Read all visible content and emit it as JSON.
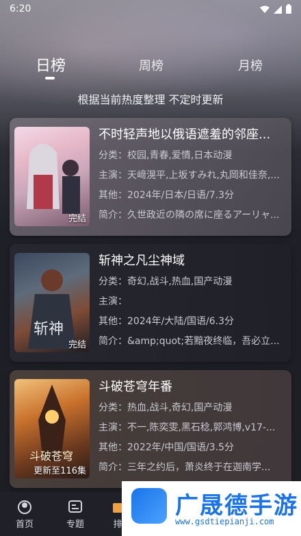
{
  "status_bar": {
    "time": "6:20"
  },
  "tabs": [
    {
      "label": "日榜",
      "active": true
    },
    {
      "label": "周榜",
      "active": false
    },
    {
      "label": "月榜",
      "active": false
    }
  ],
  "subtitle": "根据当前热度整理 不定时更新",
  "cards": [
    {
      "title": "不时轻声地以俄语遮羞的邻座...",
      "category": "分类：校园,青春,爱情,日本动漫",
      "cast": "主演：天﨑滉平,上坂すみれ,丸岡和佳奈,...",
      "other": "其他：2024年/日本/日语/7.3分",
      "summary": "简介：久世政近の隣の席に座るアーリャ...",
      "badge": "完结"
    },
    {
      "title": "斩神之凡尘神域",
      "category": "分类：奇幻,战斗,热血,国产动漫",
      "cast": "主演：",
      "other": "其他：2024年/大陆/国语/6.3分",
      "summary": "简介：&amp;quot;若黯夜终临，吾必立...",
      "badge": "完结"
    },
    {
      "title": "斗破苍穹年番",
      "category": "分类：热血,战斗,奇幻,国产动漫",
      "cast": "主演：不一,陈奕雯,黑石稔,郭鸿博,v17-...",
      "other": "其他：2022年/中国/国语/3.5分",
      "summary": "简介：三年之约后，萧炎终于在迦南学...",
      "badge": "更新至116集"
    }
  ],
  "bottom_nav": [
    {
      "label": "首页",
      "icon": "home-icon"
    },
    {
      "label": "专题",
      "icon": "topic-icon"
    },
    {
      "label": "排",
      "icon": "rank-icon"
    }
  ],
  "watermark": {
    "brand": "广晟德手游",
    "url": "www.gsdtiepianji.com"
  }
}
